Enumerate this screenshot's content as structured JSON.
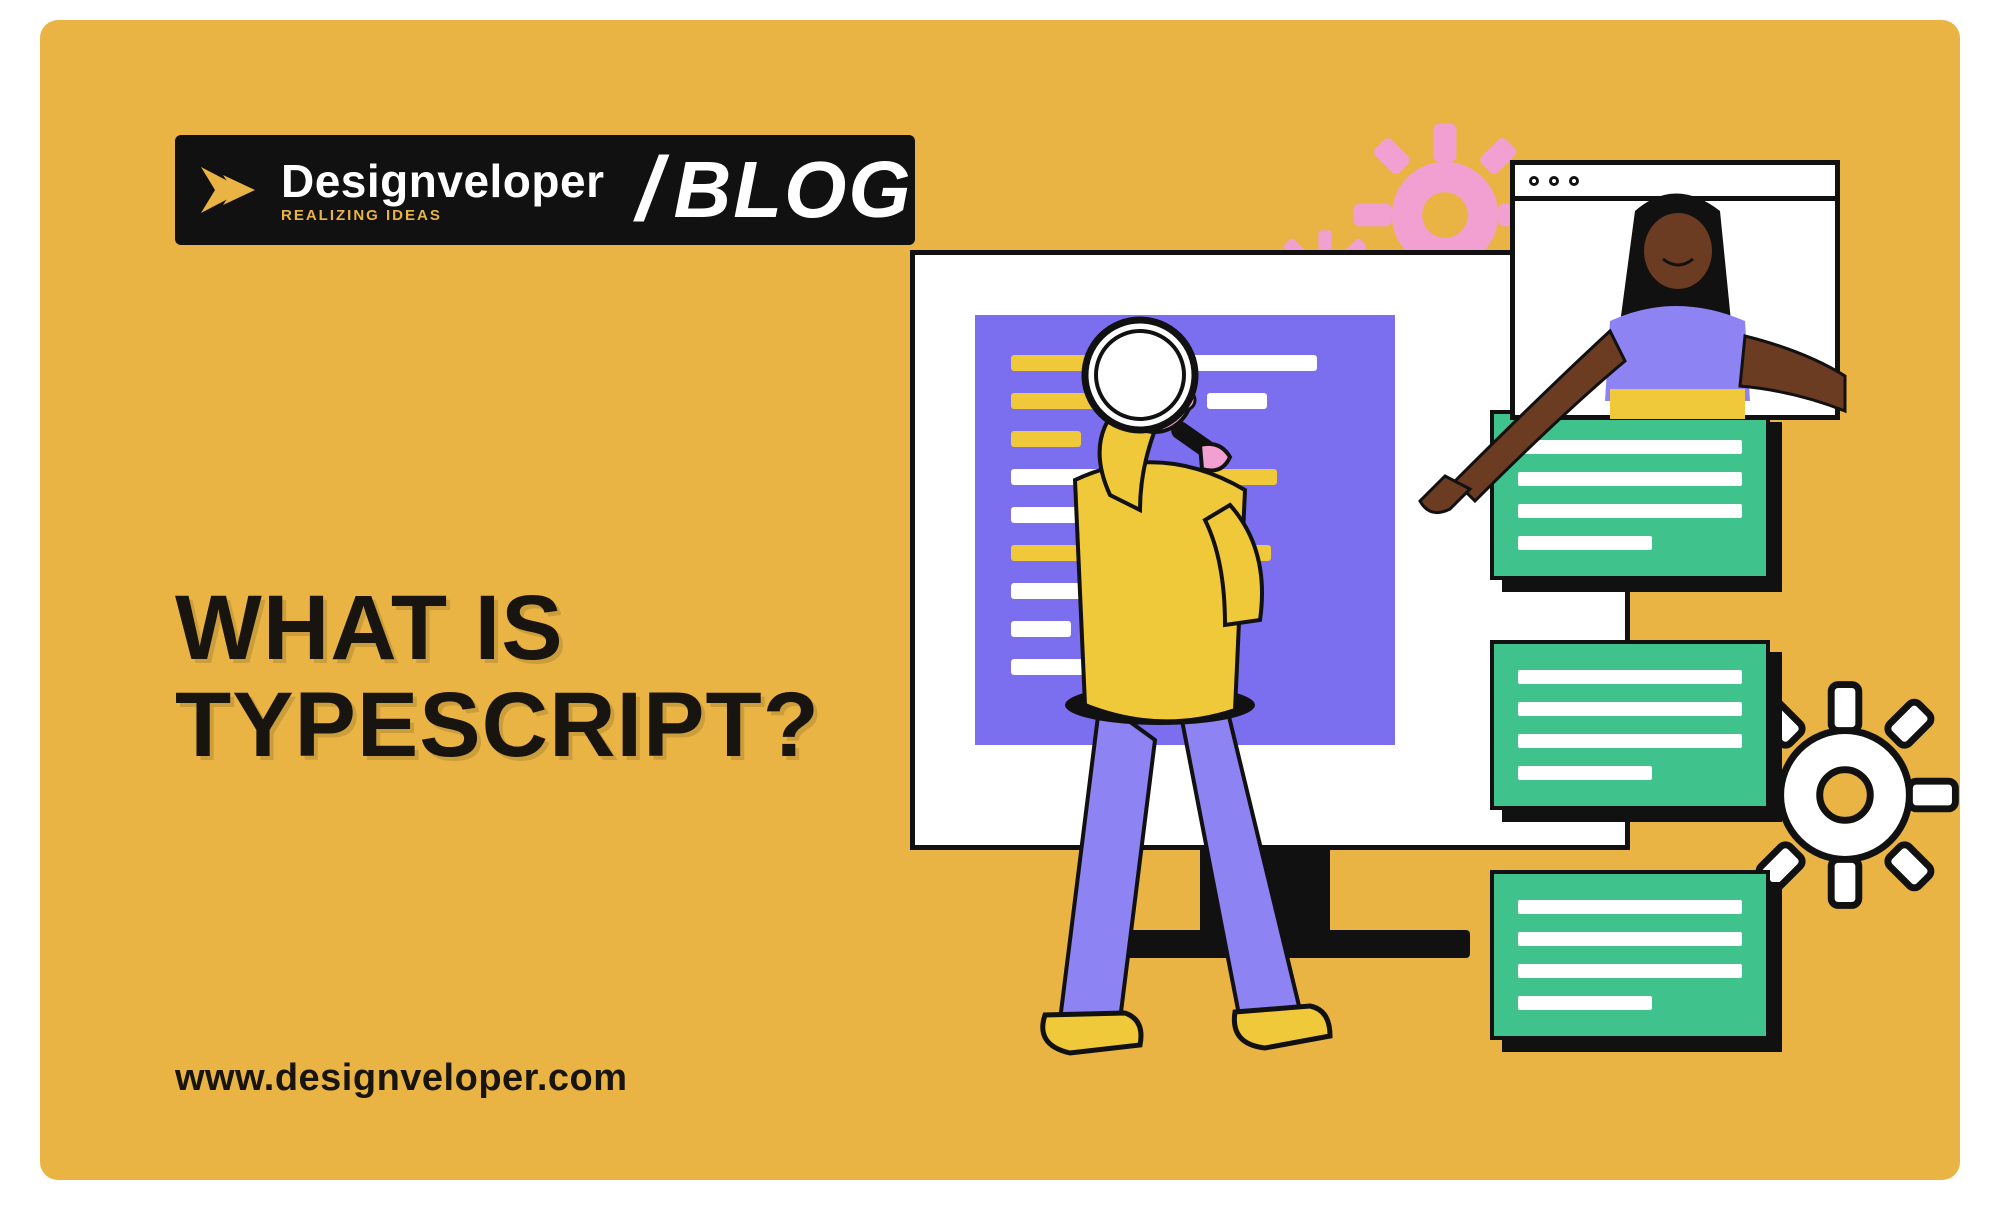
{
  "logo": {
    "brand": "Designveloper",
    "tagline": "REALIZING IDEAS",
    "slash": "/",
    "section": "BLOG",
    "mark_name": "logo-arrow-icon"
  },
  "title": "WHAT IS\nTYPESCRIPT?",
  "site_url": "www.designveloper.com",
  "colors": {
    "background": "#e9b444",
    "accent_purple": "#7B6FF0",
    "accent_green": "#3FC28B",
    "accent_pink": "#F2A0D1",
    "accent_yellow": "#F0C93A",
    "ink": "#181410"
  },
  "illustration": {
    "monitor": "code-editor-screen",
    "cards": [
      "text-card-1",
      "text-card-2",
      "text-card-3"
    ],
    "gears": [
      "pink-gear-large",
      "pink-gear-small",
      "white-gear"
    ],
    "mini_window": "browser-window-with-person",
    "main_figure": "person-with-magnifying-glass"
  }
}
